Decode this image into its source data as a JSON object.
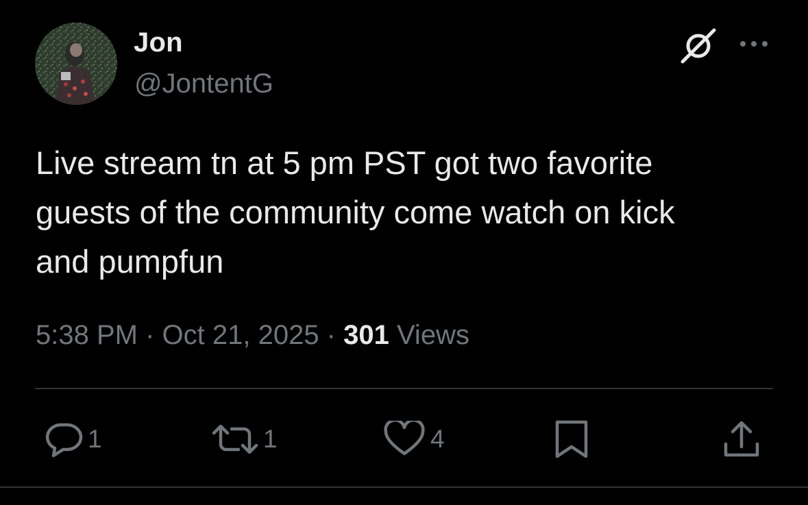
{
  "author": {
    "display_name": "Jon",
    "handle": "@JontentG"
  },
  "tweet": {
    "text": "Live stream tn at 5 pm PST got two favorite\nguests of the community come watch on kick\nand pumpfun"
  },
  "meta": {
    "time": "5:38 PM",
    "separator": " · ",
    "date": "Oct 21, 2025",
    "views_count": "301",
    "views_label": " Views"
  },
  "actions": {
    "reply_count": "1",
    "retweet_count": "1",
    "like_count": "4"
  },
  "icons": {
    "grok": "grok-icon",
    "more": "more-icon",
    "reply": "reply-icon",
    "retweet": "retweet-icon",
    "like": "heart-icon",
    "bookmark": "bookmark-icon",
    "share": "share-icon"
  },
  "colors": {
    "background": "#000000",
    "primary_text": "#e7e9ea",
    "secondary_text": "#71767b",
    "divider": "#2f3336"
  }
}
